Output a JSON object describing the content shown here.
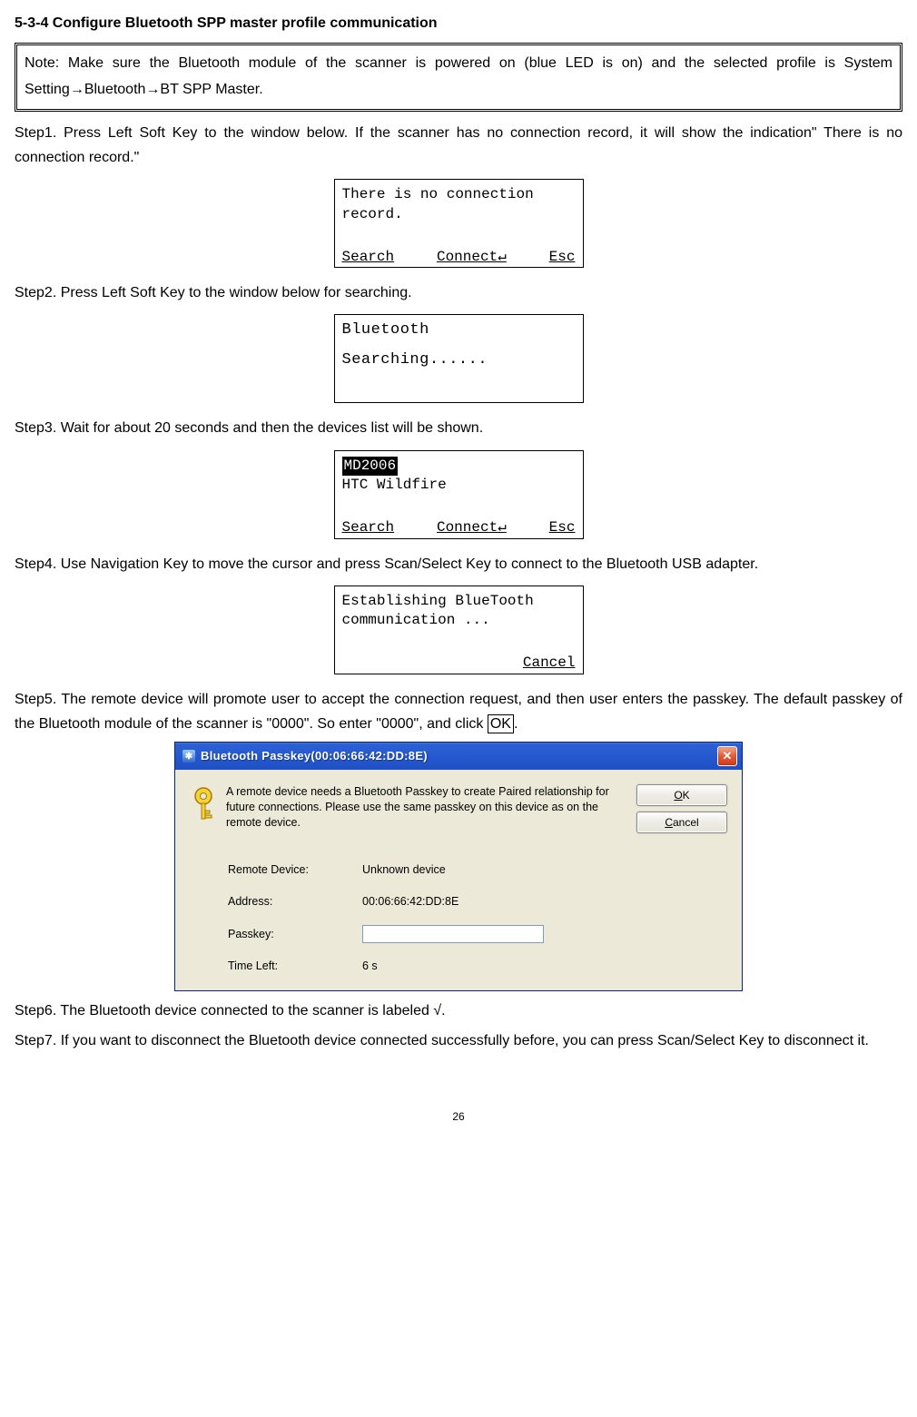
{
  "heading": "5-3-4 Configure Bluetooth SPP master profile communication",
  "note": "Note: Make sure the Bluetooth module of the scanner is powered on (blue LED is on) and the selected profile is System Setting→Bluetooth→BT SPP Master.",
  "step1": "Step1. Press Left Soft Key to the window below.   If the scanner has no connection record, it will show the indication\" There is no connection record.\"",
  "lcd1": {
    "line1": "There is no connection",
    "line2": "record.",
    "foot_left": "Search",
    "foot_mid": "Connect↵",
    "foot_right": "Esc"
  },
  "step2": "Step2. Press Left Soft Key to the window below for searching.",
  "lcd2": {
    "line1": "Bluetooth",
    "line2": "Searching......"
  },
  "step3": "Step3. Wait for about 20 seconds and then the devices list will be shown.",
  "lcd3": {
    "row_sel": "MD2006",
    "row2": "HTC Wildfire",
    "foot_left": "Search",
    "foot_mid": "Connect↵",
    "foot_right": "Esc"
  },
  "step4": "Step4. Use Navigation Key to move the cursor and press Scan/Select Key to connect to the Bluetooth USB adapter.",
  "lcd4": {
    "line1": "Establishing BlueTooth",
    "line2": "communication ...",
    "foot_right": "Cancel"
  },
  "step5_a": "Step5. The remote device will promote user to accept the connection request, and then user enters the passkey. The default passkey of the Bluetooth module of the scanner is \"0000\".   So enter \"0000\", and click ",
  "step5_b": "OK",
  "step5_c": ".",
  "xp": {
    "title": "Bluetooth Passkey(00:06:66:42:DD:8E)",
    "desc": "A remote device needs a Bluetooth Passkey to create Paired relationship for future connections. Please use the same passkey on this device as on the remote device.",
    "remote_label": "Remote Device:",
    "remote_value": "Unknown device",
    "address_label": "Address:",
    "address_value": "00:06:66:42:DD:8E",
    "passkey_label": "Passkey:",
    "timeleft_label": "Time Left:",
    "timeleft_value": "6 s"
  },
  "step6": "Step6. The Bluetooth device connected to the scanner is labeled √.",
  "step7": "Step7. If you want to disconnect the Bluetooth device connected successfully before, you can press Scan/Select Key to disconnect it.",
  "pagenum": "26"
}
